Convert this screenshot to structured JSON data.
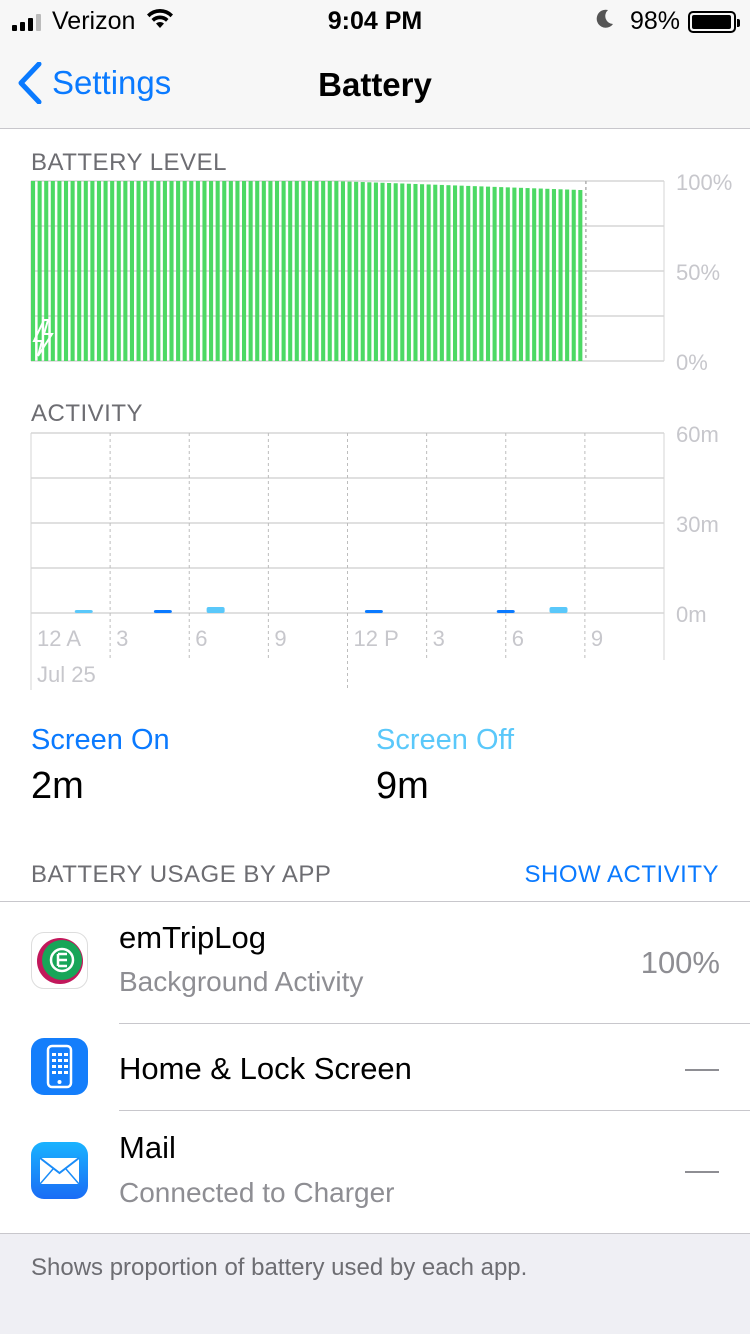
{
  "status_bar": {
    "carrier": "Verizon",
    "time": "9:04 PM",
    "battery_percent": "98%",
    "battery_level": 0.98,
    "icons": [
      "signal-icon",
      "wifi-icon",
      "moon-icon",
      "battery-icon"
    ]
  },
  "nav": {
    "back_label": "Settings",
    "title": "Battery"
  },
  "battery_level_section": {
    "label": "BATTERY LEVEL"
  },
  "activity_section": {
    "label": "ACTIVITY"
  },
  "colors": {
    "accent": "#0a7aff",
    "screen_off": "#5ac8fa",
    "battery_green": "#4cd964",
    "secondary_text": "#8e8e93"
  },
  "chart_data": [
    {
      "type": "bar",
      "title": "BATTERY LEVEL",
      "y_tick_labels": [
        "100%",
        "50%",
        "0%"
      ],
      "ylim": [
        0,
        100
      ],
      "x_range_hours": [
        0,
        21
      ],
      "values_percent_start": 100,
      "values_percent_end": 95,
      "charging_indicator": true,
      "grid": true
    },
    {
      "type": "bar",
      "title": "ACTIVITY",
      "y_tick_labels": [
        "60m",
        "30m",
        "0m"
      ],
      "ylim": [
        0,
        60
      ],
      "x_tick_labels": [
        "12 A",
        "3",
        "6",
        "9",
        "12 P",
        "3",
        "6",
        "9"
      ],
      "date_label": "Jul 25",
      "series": [
        {
          "name": "Screen On",
          "values": [
            {
              "hour": 5,
              "minutes": 1
            },
            {
              "hour": 13,
              "minutes": 1
            },
            {
              "hour": 18,
              "minutes": 1
            }
          ]
        },
        {
          "name": "Screen Off",
          "values": [
            {
              "hour": 2,
              "minutes": 1
            },
            {
              "hour": 7,
              "minutes": 2
            },
            {
              "hour": 20,
              "minutes": 2
            }
          ]
        }
      ],
      "grid": true
    }
  ],
  "stats": {
    "screen_on_label": "Screen On",
    "screen_on_value": "2m",
    "screen_off_label": "Screen Off",
    "screen_off_value": "9m"
  },
  "usage": {
    "header": "BATTERY USAGE BY APP",
    "show_activity": "SHOW ACTIVITY",
    "apps": [
      {
        "name": "emTripLog",
        "detail": "Background Activity",
        "value": "100%",
        "icon": "emtriplog-app-icon"
      },
      {
        "name": "Home & Lock Screen",
        "detail": "",
        "value": "",
        "icon": "phone-screen-icon"
      },
      {
        "name": "Mail",
        "detail": "Connected to Charger",
        "value": "",
        "icon": "mail-envelope-icon"
      }
    ]
  },
  "footer": {
    "text": "Shows proportion of battery used by each app."
  }
}
